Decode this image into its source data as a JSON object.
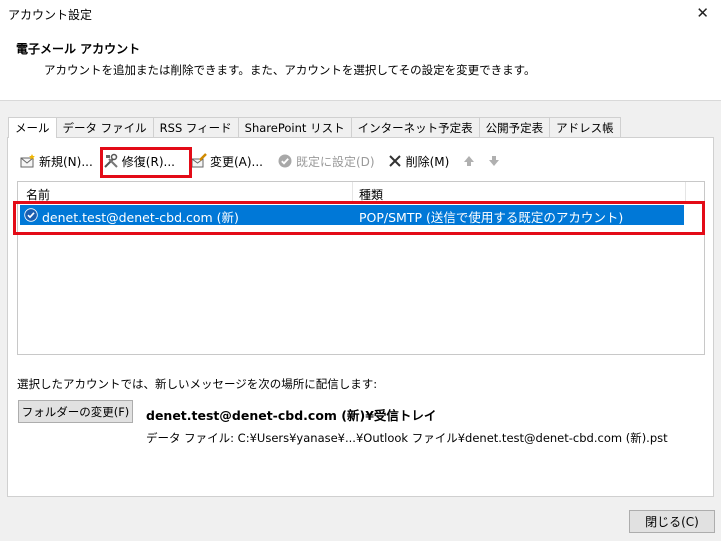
{
  "window": {
    "title": "アカウント設定",
    "close_glyph": "✕"
  },
  "header": {
    "title": "電子メール アカウント",
    "description": "アカウントを追加または削除できます。また、アカウントを選択してその設定を変更できます。"
  },
  "tabs": [
    {
      "label": "メール",
      "active": true
    },
    {
      "label": "データ ファイル"
    },
    {
      "label": "RSS フィード"
    },
    {
      "label": "SharePoint リスト"
    },
    {
      "label": "インターネット予定表"
    },
    {
      "label": "公開予定表"
    },
    {
      "label": "アドレス帳"
    }
  ],
  "toolbar": {
    "new_label": "新規(N)...",
    "repair_label": "修復(R)...",
    "change_label": "変更(A)...",
    "default_label": "既定に設定(D)",
    "delete_label": "削除(M)"
  },
  "list": {
    "columns": [
      "名前",
      "種類"
    ],
    "rows": [
      {
        "name": "denet.test@denet-cbd.com (新)",
        "type": "POP/SMTP (送信で使用する既定のアカウント)"
      }
    ]
  },
  "delivery": {
    "label": "選択したアカウントでは、新しいメッセージを次の場所に配信します:",
    "folder_button": "フォルダーの変更(F)",
    "target": "denet.test@denet-cbd.com (新)¥受信トレイ",
    "datafile": "データ ファイル: C:¥Users¥yanase¥...¥Outlook ファイル¥denet.test@denet-cbd.com (新).pst"
  },
  "footer": {
    "close_label": "閉じる(C)"
  },
  "colors": {
    "selection": "#0078d7",
    "highlight": "#e30b17"
  }
}
